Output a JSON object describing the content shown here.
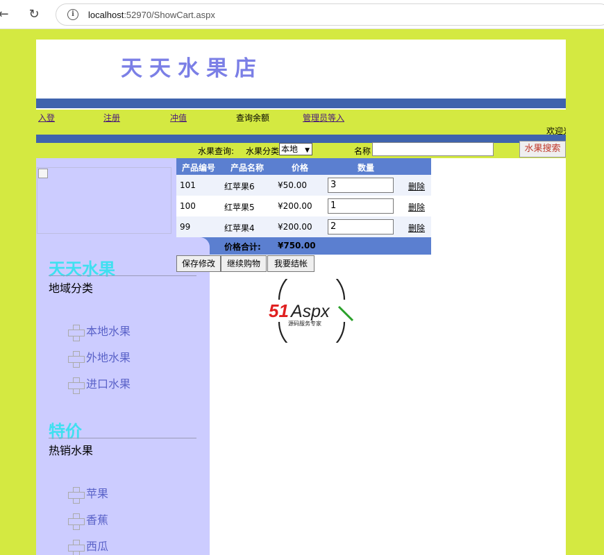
{
  "browser": {
    "url_host": "localhost",
    "url_path": ":52970/ShowCart.aspx"
  },
  "header": {
    "title": "天天水果店"
  },
  "nav": {
    "login": "入登",
    "register": "注册",
    "recharge": "冲值",
    "balance": "查询余额",
    "admin": "管理员等入",
    "welcome": "欢迎光临"
  },
  "search": {
    "label": "水果查询:",
    "category_label": "水果分类",
    "category_value": "本地",
    "name_label": "名称",
    "name_value": "",
    "button": "水果搜索"
  },
  "sidebar": {
    "section1_title": "天天水果",
    "section1_sub": "地域分类",
    "section1_items": [
      "本地水果",
      "外地水果",
      "进口水果"
    ],
    "section2_title": "特价",
    "section2_sub": "热销水果",
    "section2_items": [
      "苹果",
      "香蕉",
      "西瓜"
    ]
  },
  "cart": {
    "headers": [
      "产品编号",
      "产品名称",
      "价格",
      "数量"
    ],
    "rows": [
      {
        "id": "101",
        "name": "红苹果6",
        "price": "¥50.00",
        "qty": "3",
        "action": "删除"
      },
      {
        "id": "100",
        "name": "红苹果5",
        "price": "¥200.00",
        "qty": "1",
        "action": "删除"
      },
      {
        "id": "99",
        "name": "红苹果4",
        "price": "¥200.00",
        "qty": "2",
        "action": "删除"
      }
    ],
    "total_label": "价格合计:",
    "total_value": "¥750.00"
  },
  "actions": {
    "save": "保存修改",
    "continue": "继续购物",
    "checkout": "我要结帐"
  },
  "logo": {
    "text": "51Aspx",
    "tagline": "源码服务专家"
  },
  "colors": {
    "page_bg": "#d4e941",
    "blue_bar": "#3f63ad",
    "sidebar": "#ccccff",
    "table_header": "#5b7fd0",
    "title": "#7b7fe6"
  }
}
